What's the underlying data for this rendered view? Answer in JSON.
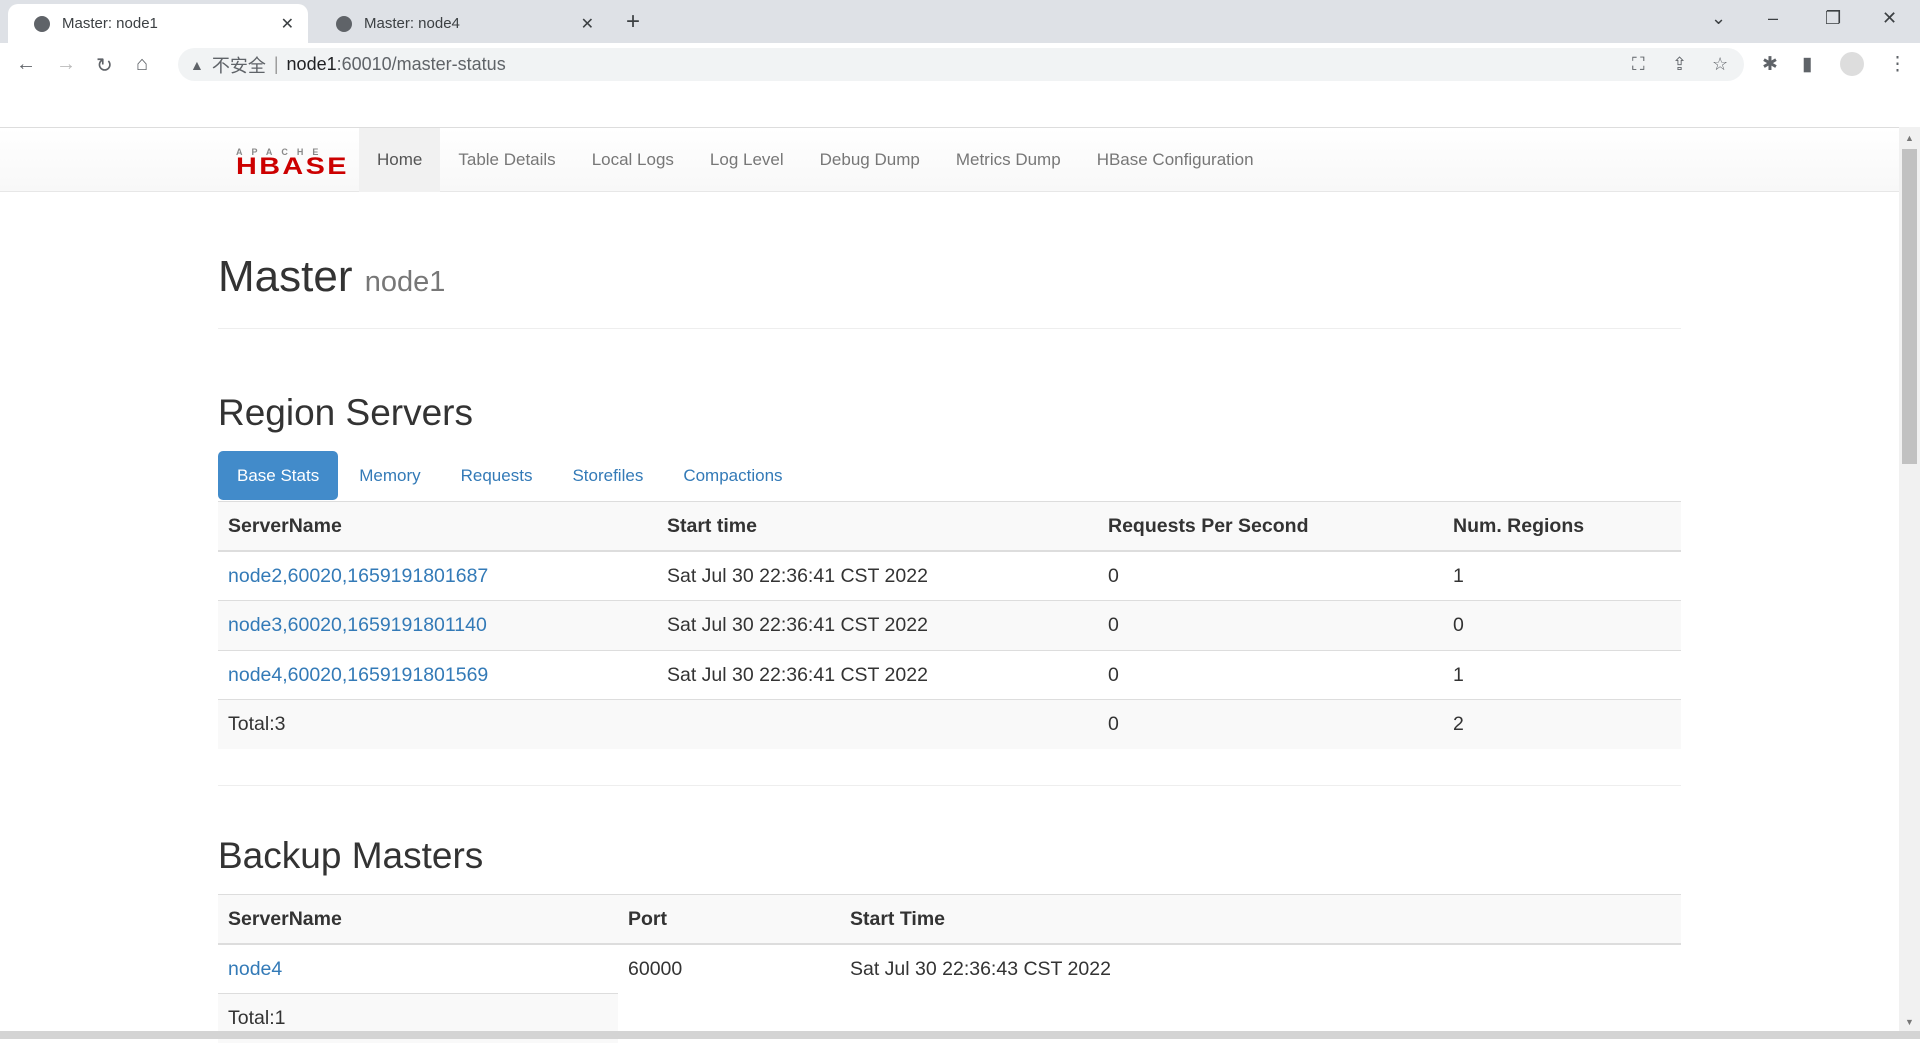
{
  "browser": {
    "tabs": [
      {
        "title": "Master: node1",
        "active": true
      },
      {
        "title": "Master: node4",
        "active": false
      }
    ],
    "address": {
      "insecure_label": "不安全",
      "host": "node1",
      "path": ":60010/master-status"
    }
  },
  "navbar": {
    "logo": {
      "top": "APACHE",
      "main": "HBASE"
    },
    "items": [
      "Home",
      "Table Details",
      "Local Logs",
      "Log Level",
      "Debug Dump",
      "Metrics Dump",
      "HBase Configuration"
    ],
    "active": "Home"
  },
  "page": {
    "title": "Master",
    "subtitle": "node1"
  },
  "region_servers": {
    "heading": "Region Servers",
    "tabs": [
      "Base Stats",
      "Memory",
      "Requests",
      "Storefiles",
      "Compactions"
    ],
    "active_tab": "Base Stats",
    "columns": [
      "ServerName",
      "Start time",
      "Requests Per Second",
      "Num. Regions"
    ],
    "rows": [
      [
        "node2,60020,1659191801687",
        "Sat Jul 30 22:36:41 CST 2022",
        "0",
        "1"
      ],
      [
        "node3,60020,1659191801140",
        "Sat Jul 30 22:36:41 CST 2022",
        "0",
        "0"
      ],
      [
        "node4,60020,1659191801569",
        "Sat Jul 30 22:36:41 CST 2022",
        "0",
        "1"
      ]
    ],
    "total": [
      "Total:3",
      "",
      "0",
      "2"
    ]
  },
  "backup_masters": {
    "heading": "Backup Masters",
    "columns": [
      "ServerName",
      "Port",
      "Start Time"
    ],
    "rows": [
      [
        "node4",
        "60000",
        "Sat Jul 30 22:36:43 CST 2022"
      ]
    ],
    "total": "Total:1"
  }
}
